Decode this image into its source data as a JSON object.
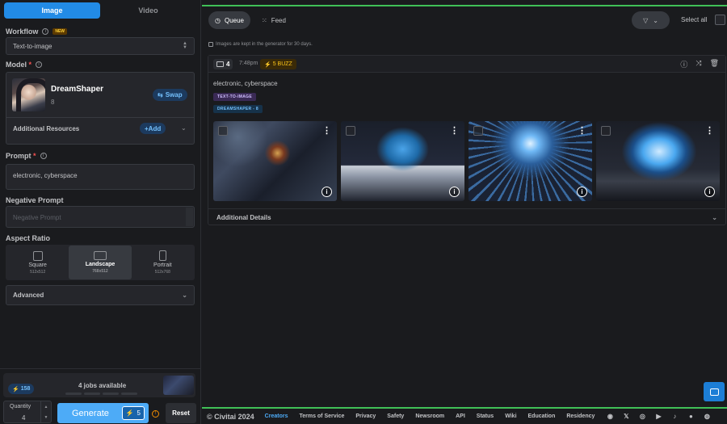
{
  "mode_tabs": [
    "Image",
    "Video"
  ],
  "workflow": {
    "label": "Workflow",
    "badge": "NEW",
    "value": "Text-to-image"
  },
  "model": {
    "label": "Model",
    "name": "DreamShaper",
    "version": "8",
    "swap": "Swap",
    "additional_resources": "Additional Resources",
    "add": "+Add"
  },
  "prompt": {
    "label": "Prompt",
    "value": "electronic, cyberspace"
  },
  "negative_prompt": {
    "label": "Negative Prompt",
    "placeholder": "Negative Prompt"
  },
  "aspect_ratio": {
    "label": "Aspect Ratio",
    "options": [
      {
        "name": "Square",
        "size": "512x512"
      },
      {
        "name": "Landscape",
        "size": "768x512"
      },
      {
        "name": "Portrait",
        "size": "512x768"
      }
    ],
    "selected": "Landscape"
  },
  "advanced": "Advanced",
  "bottom": {
    "buzz_balance": "158",
    "jobs": "4 jobs available",
    "quantity_label": "Quantity",
    "quantity": "4",
    "generate": "Generate",
    "generate_cost": "5",
    "reset": "Reset"
  },
  "right_tabs": [
    "Queue",
    "Feed"
  ],
  "select_all": "Select all",
  "notice": "Images are kept in the generator for 30 days.",
  "generation": {
    "count": "4",
    "time": "7:48pm",
    "cost": "5 BUZZ",
    "prompt": "electronic, cyberspace",
    "tags": [
      "TEXT-TO-IMAGE",
      "DREAMSHAPER - 8"
    ],
    "additional_details": "Additional Details"
  },
  "footer": {
    "copyright": "© Civitai 2024",
    "links": [
      "Creators",
      "Terms of Service",
      "Privacy",
      "Safety",
      "Newsroom",
      "API",
      "Status",
      "Wiki",
      "Education",
      "Residency"
    ],
    "social_icons": [
      "discord-icon",
      "x-icon",
      "instagram-icon",
      "youtube-icon",
      "tiktok-icon",
      "reddit-icon",
      "github-icon"
    ]
  },
  "colors": {
    "accent": "#228be6",
    "generate": "#4dabf7",
    "green_line": "#40c057",
    "buzz": "#fcc419"
  }
}
